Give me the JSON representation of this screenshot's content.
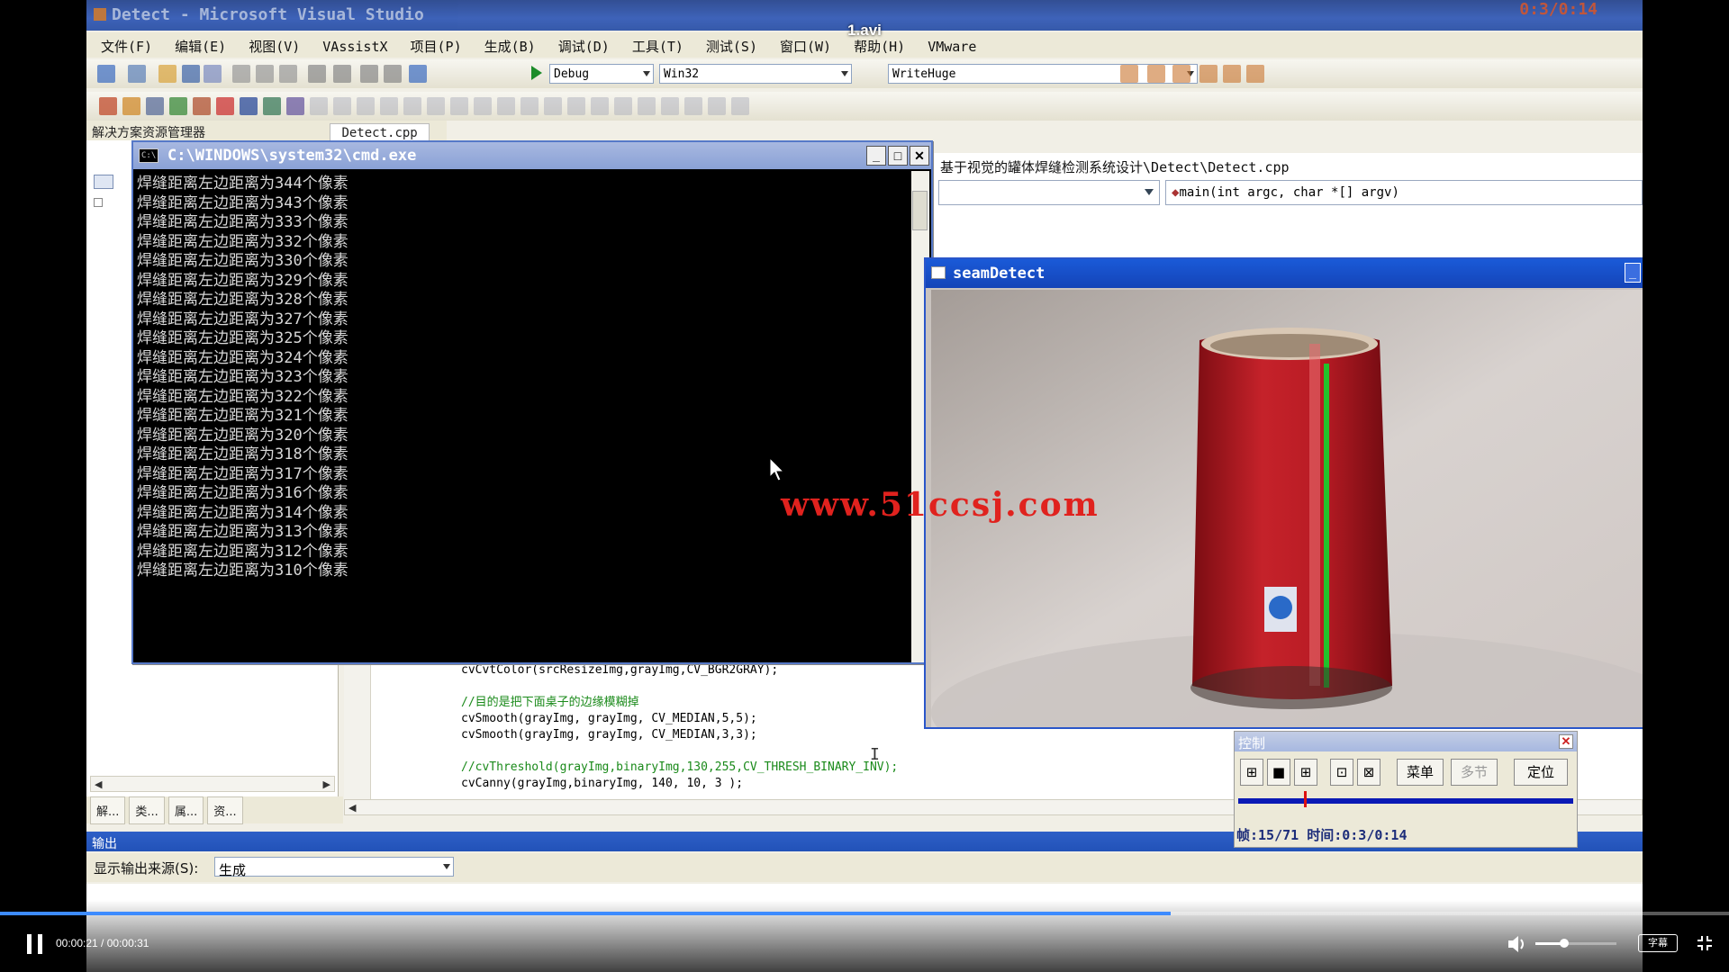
{
  "video": {
    "title": "1.avi",
    "current_time": "00:00:21",
    "duration": "00:00:31",
    "time_separator": " / ",
    "progress": 0.677,
    "volume": 0.35,
    "subtitle_label": "字幕"
  },
  "vs": {
    "window_title": "Detect - Microsoft Visual Studio",
    "clock": "0:3/0:14",
    "menu": [
      "文件(F)",
      "编辑(E)",
      "视图(V)",
      "VAssistX",
      "项目(P)",
      "生成(B)",
      "调试(D)",
      "工具(T)",
      "测试(S)",
      "窗口(W)",
      "帮助(H)",
      "VMware"
    ],
    "config_combo": "Debug",
    "platform_combo": "Win32",
    "find_combo": "WriteHuge",
    "solution_explorer_title": "解决方案资源管理器",
    "doc_tab": "Detect.cpp",
    "file_path": "基于视觉的罐体焊缝检测系统设计\\Detect\\Detect.cpp",
    "function_combo": "main(int argc, char *[] argv)",
    "sol_tabs": [
      "解...",
      "类...",
      "属...",
      "资..."
    ],
    "output_title": "输出",
    "output_source_label": "显示输出来源(S):",
    "output_source_value": "生成"
  },
  "code": [
    {
      "text": "cvCvtColor(srcResizeImg,grayImg,CV_BGR2GRAY);",
      "type": "fn"
    },
    {
      "text": "",
      "type": "fn"
    },
    {
      "text": "//目的是把下面桌子的边缘模糊掉",
      "type": "cm"
    },
    {
      "text": "cvSmooth(grayImg, grayImg, CV_MEDIAN,5,5);",
      "type": "fn"
    },
    {
      "text": "cvSmooth(grayImg, grayImg, CV_MEDIAN,3,3);",
      "type": "fn"
    },
    {
      "text": "",
      "type": "fn"
    },
    {
      "text": "//cvThreshold(grayImg,binaryImg,130,255,CV_THRESH_BINARY_INV);",
      "type": "cm"
    },
    {
      "text": "cvCanny(grayImg,binaryImg, 140, 10, 3 );",
      "type": "fn"
    }
  ],
  "cmd": {
    "title": "C:\\WINDOWS\\system32\\cmd.exe",
    "lines": [
      "焊缝距离左边距离为344个像素",
      "焊缝距离左边距离为343个像素",
      "焊缝距离左边距离为333个像素",
      "焊缝距离左边距离为332个像素",
      "焊缝距离左边距离为330个像素",
      "焊缝距离左边距离为329个像素",
      "焊缝距离左边距离为328个像素",
      "焊缝距离左边距离为327个像素",
      "焊缝距离左边距离为325个像素",
      "焊缝距离左边距离为324个像素",
      "焊缝距离左边距离为323个像素",
      "焊缝距离左边距离为322个像素",
      "焊缝距离左边距离为321个像素",
      "焊缝距离左边距离为320个像素",
      "焊缝距离左边距离为318个像素",
      "焊缝距离左边距离为317个像素",
      "焊缝距离左边距离为316个像素",
      "焊缝距离左边距离为314个像素",
      "焊缝距离左边距离为313个像素",
      "焊缝距离左边距离为312个像素",
      "焊缝距离左边距离为310个像素"
    ]
  },
  "seam": {
    "title": "seamDetect"
  },
  "control": {
    "title": "控制",
    "menu_label": "菜单",
    "step_label": "多节",
    "locate_label": "定位",
    "frame_position": 0.197,
    "info": "帧:15/71 时间:0:3/0:14"
  },
  "watermark": "www.51ccsj.com",
  "colors": {
    "progress": "#3d8bff",
    "title_bar": "#2a53b4",
    "seam_line": "#22c12a",
    "can_red": "#b51a22"
  }
}
